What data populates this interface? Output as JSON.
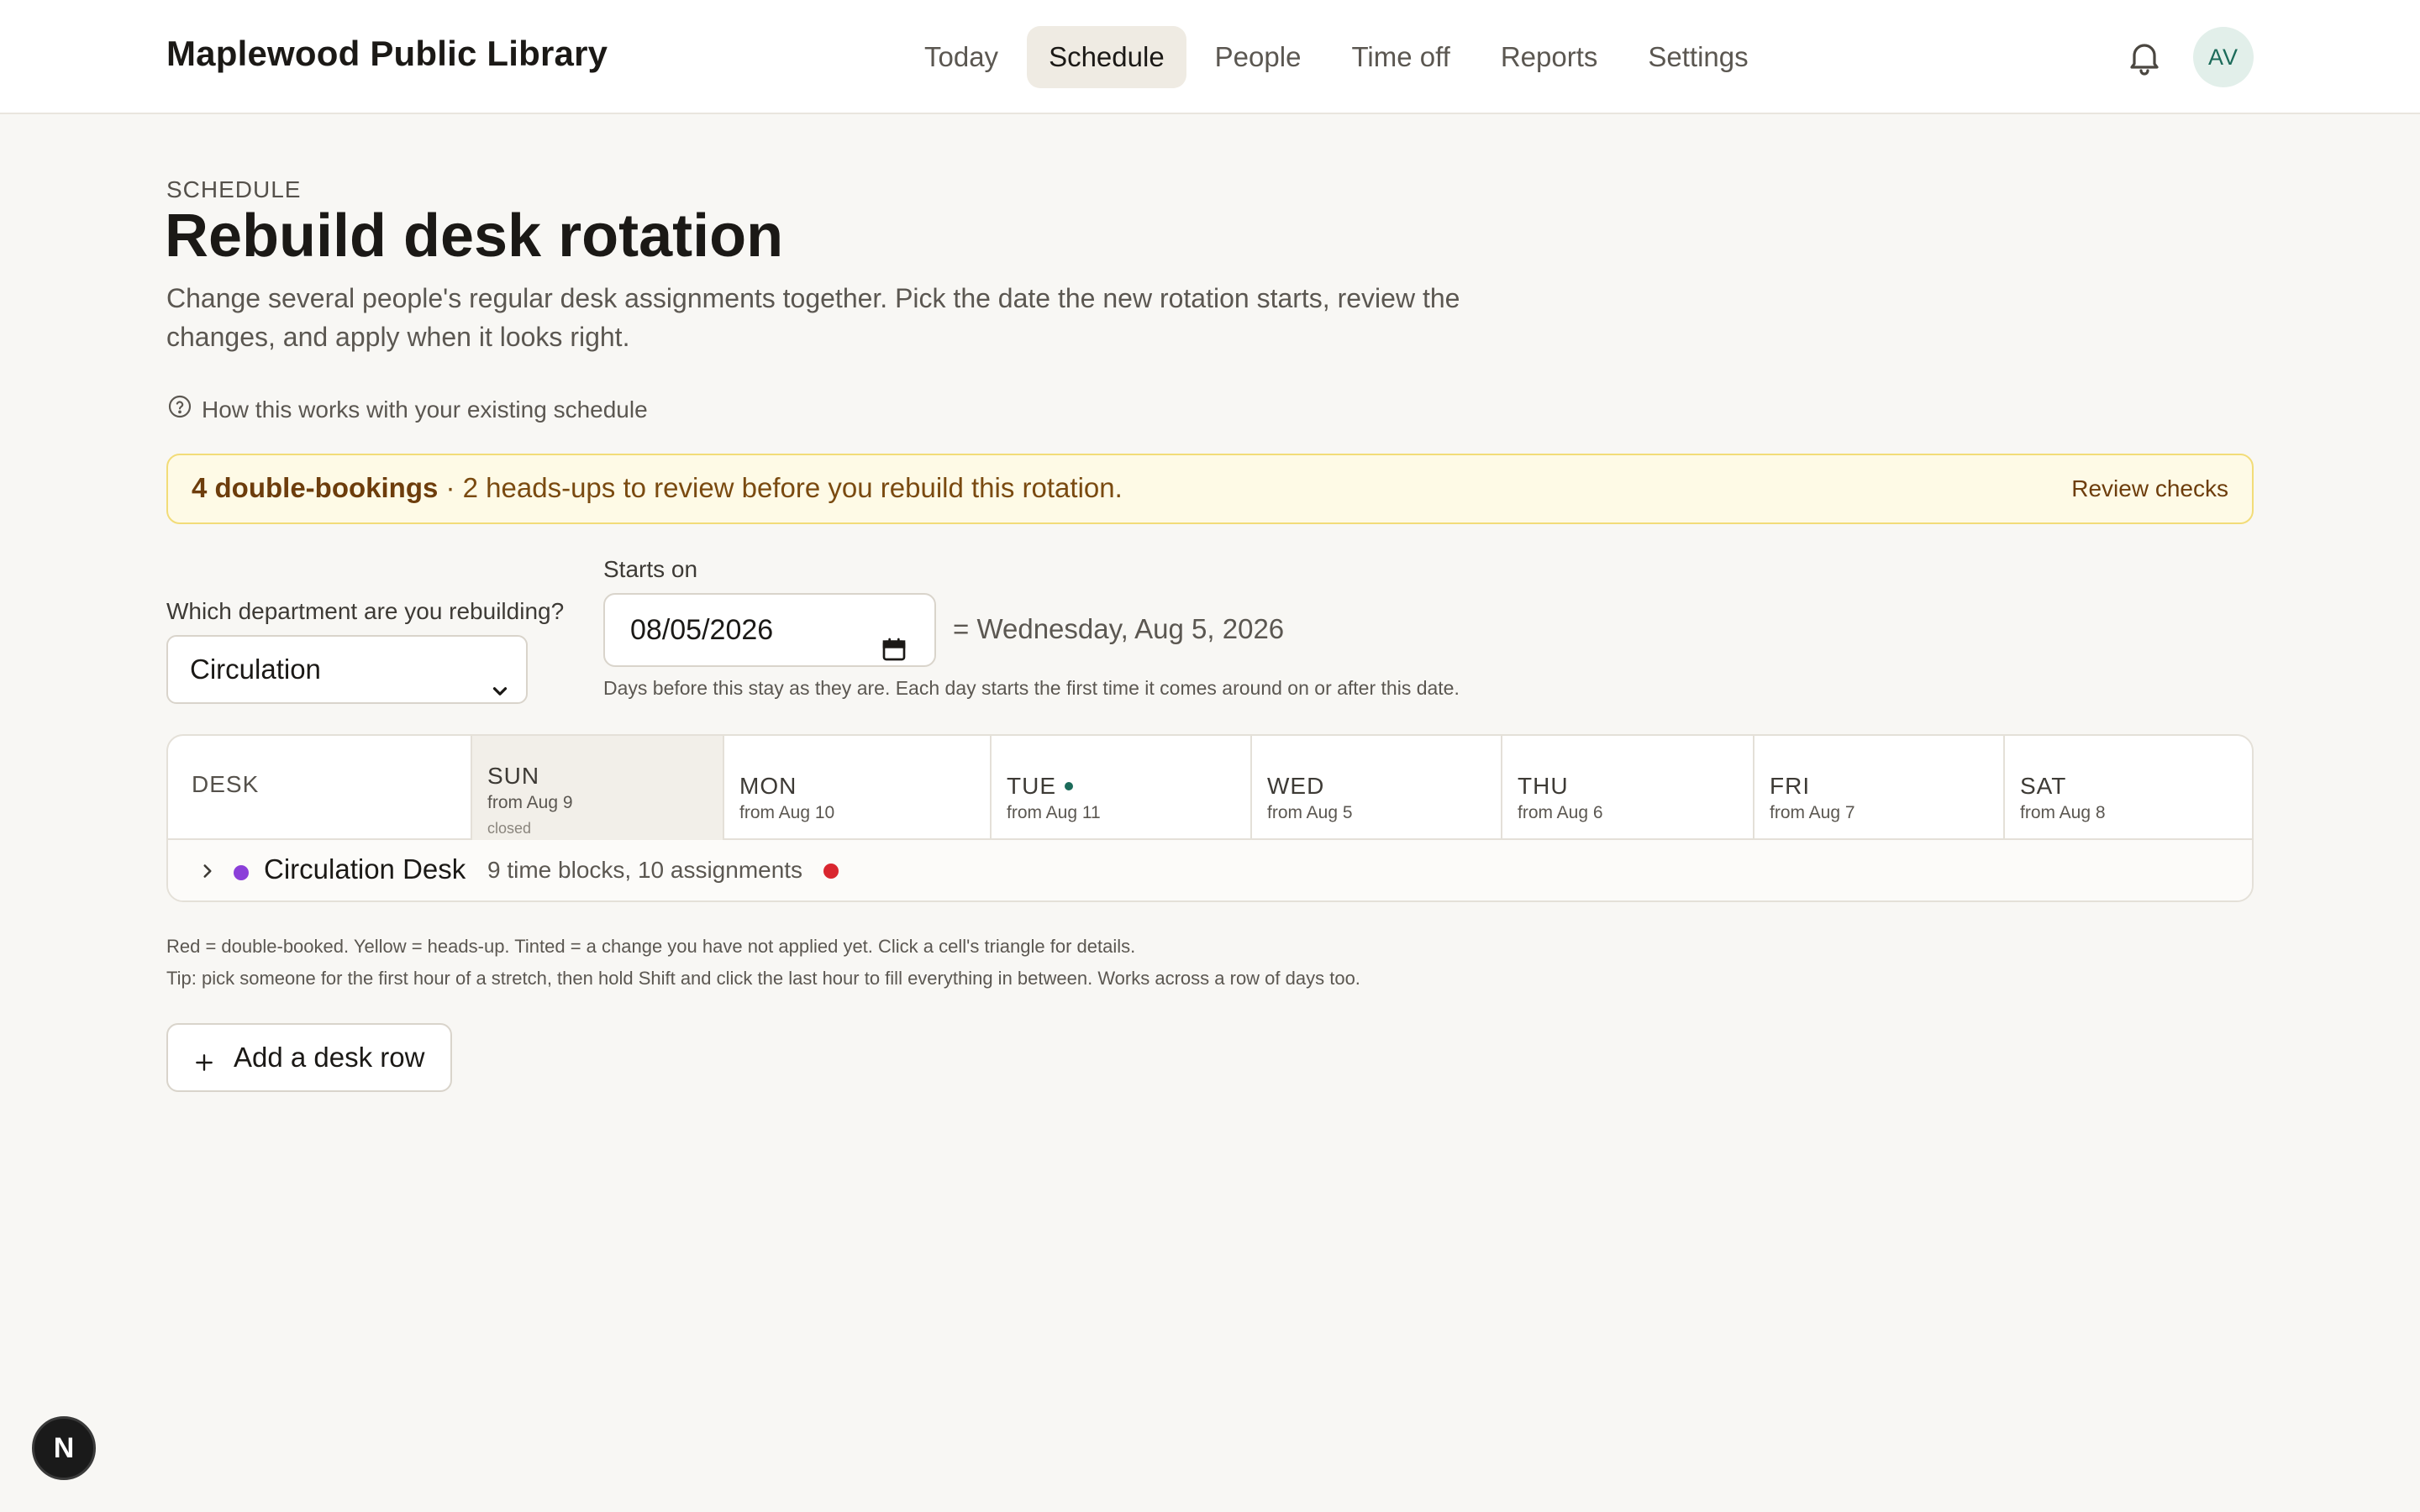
{
  "app": {
    "title": "Maplewood Public Library"
  },
  "nav": {
    "items": [
      {
        "label": "Today"
      },
      {
        "label": "Schedule"
      },
      {
        "label": "People"
      },
      {
        "label": "Time off"
      },
      {
        "label": "Reports"
      },
      {
        "label": "Settings"
      }
    ],
    "active": "Schedule"
  },
  "user": {
    "initials": "AV"
  },
  "header": {
    "eyebrow": "SCHEDULE",
    "title": "Rebuild desk rotation",
    "description": "Change several people's regular desk assignments together. Pick the date the new rotation starts, review the changes, and apply when it looks right.",
    "help_link": "How this works with your existing schedule"
  },
  "alert": {
    "strong": "4 double-bookings",
    "rest": " · 2 heads-ups to review before you rebuild this rotation.",
    "action": "Review checks"
  },
  "form": {
    "department_label": "Which department are you rebuilding?",
    "department_value": "Circulation",
    "starts_label": "Starts on",
    "starts_value": "08/05/2026",
    "starts_readable": "= Wednesday, Aug 5, 2026",
    "starts_hint": "Days before this stay as they are. Each day starts the first time it comes around on or after this date."
  },
  "grid": {
    "desk_header": "DESK",
    "days": [
      {
        "name": "SUN",
        "from": "from Aug 9",
        "note": "closed"
      },
      {
        "name": "MON",
        "from": "from Aug 10"
      },
      {
        "name": "TUE",
        "from": "from Aug 11"
      },
      {
        "name": "WED",
        "from": "from Aug 5"
      },
      {
        "name": "THU",
        "from": "from Aug 6"
      },
      {
        "name": "FRI",
        "from": "from Aug 7"
      },
      {
        "name": "SAT",
        "from": "from Aug 8"
      }
    ],
    "rows": [
      {
        "name": "Circulation Desk",
        "meta": "9 time blocks, 10 assignments"
      }
    ]
  },
  "notes": {
    "legend": "Red = double-booked. Yellow = heads-up. Tinted = a change you have not applied yet. Click a cell's triangle for details.",
    "tip": "Tip: pick someone for the first hour of a stretch, then hold Shift and click the last hour to fill everything in between. Works across a row of days too."
  },
  "actions": {
    "add_row": "Add a desk row"
  },
  "badge": {
    "letter": "N"
  },
  "colors": {
    "accent_teal": "#1c6b5a",
    "desk_purple": "#8b3fd9",
    "conflict_red": "#d9262f",
    "alert_bg": "#fefae6",
    "alert_border": "#f2dc78"
  }
}
